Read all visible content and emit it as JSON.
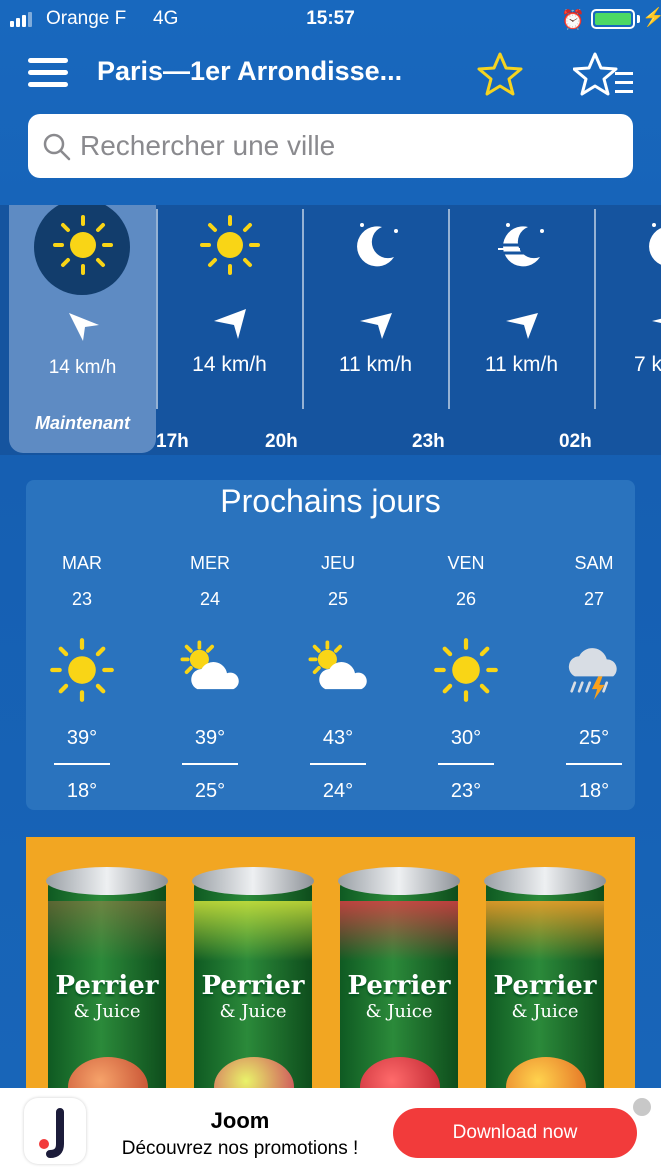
{
  "status_bar": {
    "carrier": "Orange F",
    "network": "4G",
    "time": "15:57",
    "battery_color": "#4cd964"
  },
  "header": {
    "title": "Paris—1er Arrondisse...",
    "icons": [
      "menu-icon",
      "star-icon",
      "favorites-list-icon"
    ],
    "star_color": "#f5d320"
  },
  "search": {
    "placeholder": "Rechercher une ville"
  },
  "hourly": {
    "now_label": "Maintenant",
    "columns": [
      {
        "icon": "sun-icon",
        "wind": "14 km/h",
        "wind_direction": "north-west"
      },
      {
        "icon": "sun-icon",
        "wind": "14 km/h",
        "wind_direction": "west"
      },
      {
        "icon": "moon-icon",
        "wind": "11 km/h",
        "wind_direction": "west"
      },
      {
        "icon": "moon-fog-icon",
        "wind": "11 km/h",
        "wind_direction": "west"
      },
      {
        "icon": "moon-icon",
        "wind": "7 k",
        "wind_direction": "west"
      }
    ],
    "hour_labels": [
      "17h",
      "20h",
      "23h",
      "02h"
    ]
  },
  "days": {
    "title": "Prochains jours",
    "items": [
      {
        "name": "MAR",
        "num": "23",
        "icon": "sun-icon",
        "max": "39°",
        "min": "18°"
      },
      {
        "name": "MER",
        "num": "24",
        "icon": "partly-cloudy-icon",
        "max": "39°",
        "min": "25°"
      },
      {
        "name": "JEU",
        "num": "25",
        "icon": "partly-cloudy-icon",
        "max": "43°",
        "min": "24°"
      },
      {
        "name": "VEN",
        "num": "26",
        "icon": "sun-icon",
        "max": "30°",
        "min": "23°"
      },
      {
        "name": "SAM",
        "num": "27",
        "icon": "thunderstorm-icon",
        "max": "25°",
        "min": "18°"
      }
    ]
  },
  "ad": {
    "brand": "Perrier",
    "brand_sub": "& Juice"
  },
  "banner": {
    "app_name": "Joom",
    "promo": "Découvrez nos promotions !",
    "button": "Download now",
    "button_color": "#f23b3b"
  },
  "colors": {
    "background": "#1866b9",
    "hourly_bg": "#15549f",
    "now_panel": "#5e8bc3",
    "days_panel": "#2a73be",
    "sun": "#f9d516"
  }
}
